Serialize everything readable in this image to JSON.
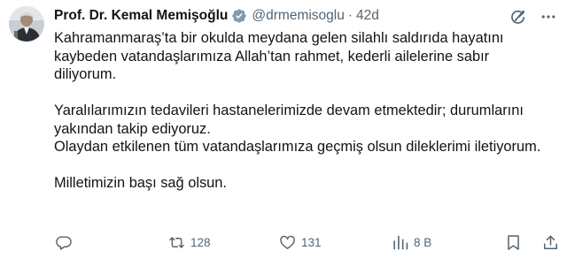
{
  "author": {
    "name": "Prof. Dr. Kemal Memişoğlu",
    "handle": "@drmemisoglu",
    "separator": "·",
    "time": "42d",
    "verified_icon": "verified-badge-icon",
    "verified_color": "#829aab"
  },
  "header_actions": {
    "grok_icon": "grok-icon",
    "more_icon": "more-horizontal-icon"
  },
  "body": {
    "paragraphs": [
      "Kahramanmaraş’ta bir okulda meydana gelen silahlı saldırıda hayatını kaybeden vatandaşlarımıza Allah’tan rahmet, kederli ailelerine sabır diliyorum.",
      "Yaralılarımızın tedavileri hastanelerimizde devam etmektedir; durumlarını yakından takip ediyoruz.",
      "Olaydan etkilenen tüm vatandaşlarımıza geçmiş olsun dileklerimi iletiyorum.",
      "Milletimizin başı sağ olsun."
    ]
  },
  "actions": {
    "reply": {
      "icon": "reply-icon",
      "count": ""
    },
    "retweet": {
      "icon": "retweet-icon",
      "count": "128"
    },
    "like": {
      "icon": "heart-icon",
      "count": "131"
    },
    "views": {
      "icon": "views-chart-icon",
      "count": "8 B"
    },
    "bookmark": {
      "icon": "bookmark-icon"
    },
    "share": {
      "icon": "share-icon"
    }
  },
  "colors": {
    "text": "#0f1419",
    "secondary": "#536471",
    "background": "#ffffff"
  }
}
